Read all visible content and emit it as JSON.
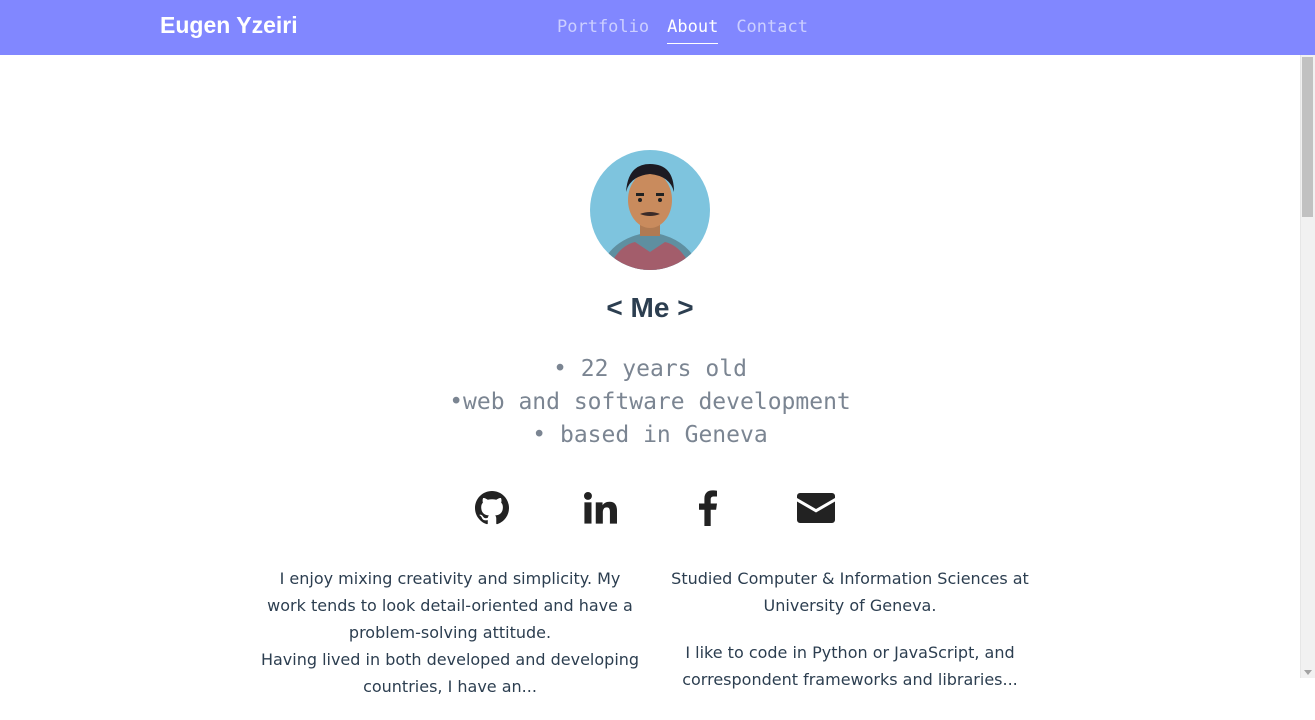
{
  "navbar": {
    "brand": "Eugen Yzeiri",
    "links": [
      {
        "label": "Portfolio",
        "active": false
      },
      {
        "label": "About",
        "active": true
      },
      {
        "label": "Contact",
        "active": false
      }
    ],
    "background": "#8187ff"
  },
  "profile": {
    "heading": "< Me >",
    "bullets": [
      "• 22 years old",
      "•web and software development",
      "• based in Geneva"
    ]
  },
  "socials": [
    {
      "icon": "github-icon"
    },
    {
      "icon": "linkedin-icon"
    },
    {
      "icon": "facebook-icon"
    },
    {
      "icon": "envelope-icon"
    }
  ],
  "bio": {
    "left": "I enjoy mixing creativity and simplicity. My work tends to look detail-oriented and have a problem-solving attitude.\nHaving lived in both developed and developing countries, I have an...",
    "right_1": "Studied Computer & Information Sciences at University of Geneva.",
    "right_2": "I like to code in Python or JavaScript, and correspondent frameworks and libraries..."
  },
  "colors": {
    "text_dark": "#2c3e50",
    "text_muted": "#7b8592"
  }
}
